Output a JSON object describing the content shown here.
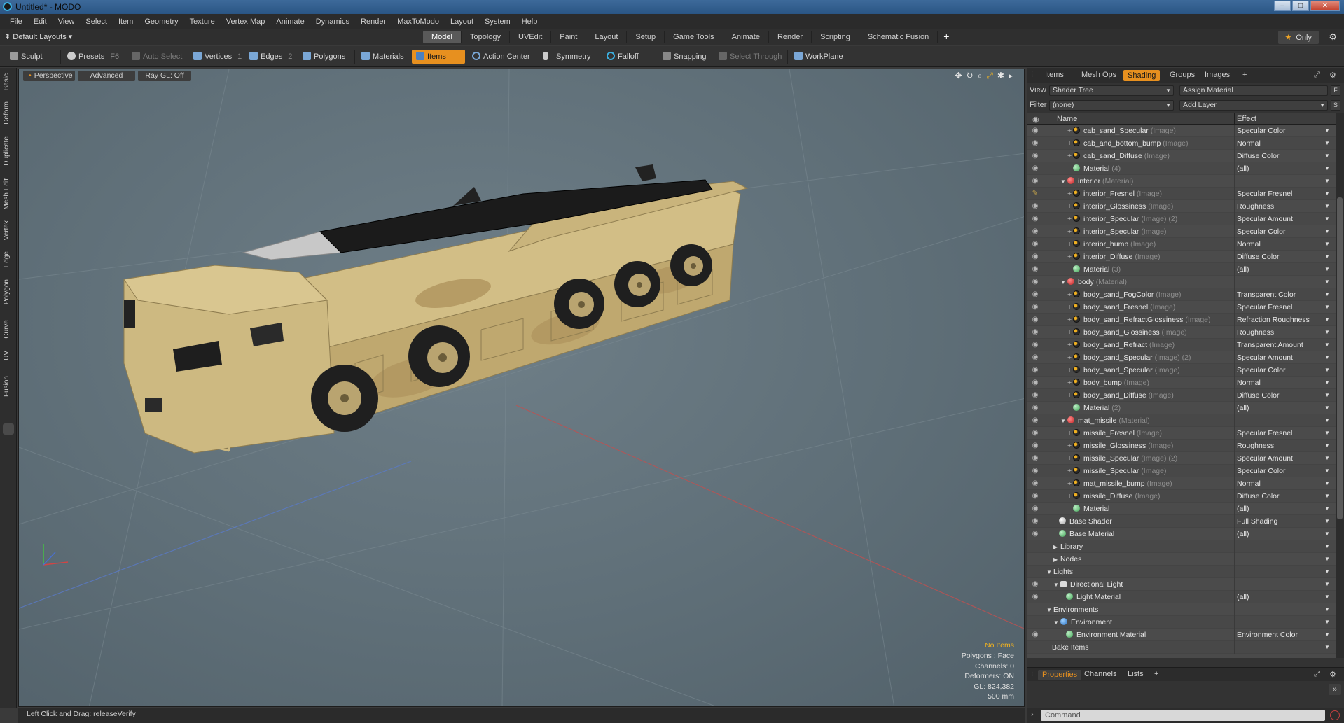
{
  "window": {
    "title": "Untitled* - MODO",
    "buttons": [
      "–",
      "□",
      "✕"
    ]
  },
  "menu": [
    "File",
    "Edit",
    "View",
    "Select",
    "Item",
    "Geometry",
    "Texture",
    "Vertex Map",
    "Animate",
    "Dynamics",
    "Render",
    "MaxToModo",
    "Layout",
    "System",
    "Help"
  ],
  "layouts": {
    "default_label": "Default Layouts ▾",
    "tabs": [
      "Model",
      "Topology",
      "UVEdit",
      "Paint",
      "Layout",
      "Setup",
      "Game Tools",
      "Animate",
      "Render",
      "Scripting",
      "Schematic Fusion"
    ],
    "active_tab": "Model",
    "plus": "+",
    "only": "Only"
  },
  "toolbar": {
    "sculpt": "Sculpt",
    "presets": "Presets",
    "presets_key": "F6",
    "auto_select": "Auto Select",
    "vertices": "Vertices",
    "vertices_key": "1",
    "edges": "Edges",
    "edges_key": "2",
    "polygons": "Polygons",
    "materials": "Materials",
    "items": "Items",
    "action_center": "Action Center",
    "symmetry": "Symmetry",
    "falloff": "Falloff",
    "snapping": "Snapping",
    "select_through": "Select Through",
    "workplane": "WorkPlane"
  },
  "left_strip": [
    "Basic",
    "Deform",
    "Duplicate",
    "Mesh Edit",
    "Vertex",
    "Edge",
    "Polygon",
    "Curve",
    "UV",
    "Fusion"
  ],
  "viewport": {
    "view_mode": "Perspective",
    "advanced": "Advanced",
    "raygl": "Ray GL: Off",
    "info": {
      "selection": "No Items",
      "polygons": "Polygons : Face",
      "channels": "Channels: 0",
      "deformers": "Deformers: ON",
      "gl": "GL: 824,382",
      "scale": "500 mm"
    }
  },
  "status": {
    "hint": "Left Click and Drag:   releaseVerify"
  },
  "panel": {
    "tabs": [
      "Items",
      "Mesh Ops",
      "Shading",
      "Groups",
      "Images",
      "+"
    ],
    "active_tab": "Shading",
    "view_label": "View",
    "view_value": "Shader Tree",
    "assign_material": "Assign Material",
    "filter_label": "Filter",
    "filter_value": "(none)",
    "add_layer": "Add Layer",
    "f_btn": "F",
    "s_btn": "S",
    "col_name": "Name",
    "col_effect": "Effect",
    "rows": [
      {
        "indent": 4,
        "plus": true,
        "icon": "image",
        "name": "cab_sand_Specular",
        "type": "(Image)",
        "effect": "Specular Color",
        "eye": "eye"
      },
      {
        "indent": 4,
        "plus": true,
        "icon": "image",
        "name": "cab_and_bottom_bump",
        "type": "(Image)",
        "effect": "Normal",
        "eye": "eye"
      },
      {
        "indent": 4,
        "plus": true,
        "icon": "image",
        "name": "cab_sand_Diffuse",
        "type": "(Image)",
        "effect": "Diffuse Color",
        "eye": "eye"
      },
      {
        "indent": 4,
        "plus": false,
        "icon": "material",
        "name": "Material",
        "type": "(4)",
        "effect": "(all)",
        "eye": "eye"
      },
      {
        "indent": 3,
        "twist": "▼",
        "icon": "mask",
        "name": "interior",
        "type": "(Material)",
        "effect": "",
        "eye": "eye"
      },
      {
        "indent": 4,
        "plus": true,
        "icon": "image",
        "name": "interior_Fresnel",
        "type": "(Image)",
        "effect": "Specular Fresnel",
        "eye": "brush"
      },
      {
        "indent": 4,
        "plus": true,
        "icon": "image",
        "name": "interior_Glossiness",
        "type": "(Image)",
        "effect": "Roughness",
        "eye": "eye"
      },
      {
        "indent": 4,
        "plus": true,
        "icon": "image",
        "name": "interior_Specular",
        "type": "(Image) (2)",
        "effect": "Specular Amount",
        "eye": "eye"
      },
      {
        "indent": 4,
        "plus": true,
        "icon": "image",
        "name": "interior_Specular",
        "type": "(Image)",
        "effect": "Specular Color",
        "eye": "eye"
      },
      {
        "indent": 4,
        "plus": true,
        "icon": "image",
        "name": "interior_bump",
        "type": "(Image)",
        "effect": "Normal",
        "eye": "eye"
      },
      {
        "indent": 4,
        "plus": true,
        "icon": "image",
        "name": "interior_Diffuse",
        "type": "(Image)",
        "effect": "Diffuse Color",
        "eye": "eye"
      },
      {
        "indent": 4,
        "plus": false,
        "icon": "material",
        "name": "Material",
        "type": "(3)",
        "effect": "(all)",
        "eye": "eye"
      },
      {
        "indent": 3,
        "twist": "▼",
        "icon": "mask",
        "name": "body",
        "type": "(Material)",
        "effect": "",
        "eye": "eye"
      },
      {
        "indent": 4,
        "plus": true,
        "icon": "image",
        "name": "body_sand_FogColor",
        "type": "(Image)",
        "effect": "Transparent Color",
        "eye": "eye"
      },
      {
        "indent": 4,
        "plus": true,
        "icon": "image",
        "name": "body_sand_Fresnel",
        "type": "(Image)",
        "effect": "Specular Fresnel",
        "eye": "eye"
      },
      {
        "indent": 4,
        "plus": true,
        "icon": "image",
        "name": "body_sand_RefractGlossiness",
        "type": "(Image)",
        "effect": "Refraction Roughness",
        "eye": "eye"
      },
      {
        "indent": 4,
        "plus": true,
        "icon": "image",
        "name": "body_sand_Glossiness",
        "type": "(Image)",
        "effect": "Roughness",
        "eye": "eye"
      },
      {
        "indent": 4,
        "plus": true,
        "icon": "image",
        "name": "body_sand_Refract",
        "type": "(Image)",
        "effect": "Transparent Amount",
        "eye": "eye"
      },
      {
        "indent": 4,
        "plus": true,
        "icon": "image",
        "name": "body_sand_Specular",
        "type": "(Image) (2)",
        "effect": "Specular Amount",
        "eye": "eye"
      },
      {
        "indent": 4,
        "plus": true,
        "icon": "image",
        "name": "body_sand_Specular",
        "type": "(Image)",
        "effect": "Specular Color",
        "eye": "eye"
      },
      {
        "indent": 4,
        "plus": true,
        "icon": "image",
        "name": "body_bump",
        "type": "(Image)",
        "effect": "Normal",
        "eye": "eye"
      },
      {
        "indent": 4,
        "plus": true,
        "icon": "image",
        "name": "body_sand_Diffuse",
        "type": "(Image)",
        "effect": "Diffuse Color",
        "eye": "eye"
      },
      {
        "indent": 4,
        "plus": false,
        "icon": "material",
        "name": "Material",
        "type": "(2)",
        "effect": "(all)",
        "eye": "eye"
      },
      {
        "indent": 3,
        "twist": "▼",
        "icon": "mask",
        "name": "mat_missile",
        "type": "(Material)",
        "effect": "",
        "eye": "eye"
      },
      {
        "indent": 4,
        "plus": true,
        "icon": "image",
        "name": "missile_Fresnel",
        "type": "(Image)",
        "effect": "Specular Fresnel",
        "eye": "eye"
      },
      {
        "indent": 4,
        "plus": true,
        "icon": "image",
        "name": "missile_Glossiness",
        "type": "(Image)",
        "effect": "Roughness",
        "eye": "eye"
      },
      {
        "indent": 4,
        "plus": true,
        "icon": "image",
        "name": "missile_Specular",
        "type": "(Image) (2)",
        "effect": "Specular Amount",
        "eye": "eye"
      },
      {
        "indent": 4,
        "plus": true,
        "icon": "image",
        "name": "missile_Specular",
        "type": "(Image)",
        "effect": "Specular Color",
        "eye": "eye"
      },
      {
        "indent": 4,
        "plus": true,
        "icon": "image",
        "name": "mat_missile_bump",
        "type": "(Image)",
        "effect": "Normal",
        "eye": "eye"
      },
      {
        "indent": 4,
        "plus": true,
        "icon": "image",
        "name": "missile_Diffuse",
        "type": "(Image)",
        "effect": "Diffuse Color",
        "eye": "eye"
      },
      {
        "indent": 4,
        "plus": false,
        "icon": "material",
        "name": "Material",
        "type": "",
        "effect": "(all)",
        "eye": "eye"
      },
      {
        "indent": 2,
        "plus": false,
        "icon": "shader",
        "name": "Base Shader",
        "type": "",
        "effect": "Full Shading",
        "eye": "eye"
      },
      {
        "indent": 2,
        "plus": false,
        "icon": "material",
        "name": "Base Material",
        "type": "",
        "effect": "(all)",
        "eye": "eye"
      },
      {
        "indent": 2,
        "twist": "▶",
        "icon": "",
        "name": "Library",
        "type": "",
        "effect": "",
        "eye": ""
      },
      {
        "indent": 2,
        "twist": "▶",
        "icon": "",
        "name": "Nodes",
        "type": "",
        "effect": "",
        "eye": ""
      },
      {
        "indent": 1,
        "twist": "▼",
        "icon": "",
        "name": "Lights",
        "type": "",
        "effect": "",
        "eye": ""
      },
      {
        "indent": 2,
        "twist": "▼",
        "icon": "light",
        "name": "Directional Light",
        "type": "",
        "effect": "",
        "eye": "eye"
      },
      {
        "indent": 3,
        "plus": false,
        "icon": "material",
        "name": "Light Material",
        "type": "",
        "effect": "(all)",
        "eye": "eye"
      },
      {
        "indent": 1,
        "twist": "▼",
        "icon": "",
        "name": "Environments",
        "type": "",
        "effect": "",
        "eye": ""
      },
      {
        "indent": 2,
        "twist": "▼",
        "icon": "env",
        "name": "Environment",
        "type": "",
        "effect": "",
        "eye": ""
      },
      {
        "indent": 3,
        "plus": false,
        "icon": "material",
        "name": "Environment Material",
        "type": "",
        "effect": "Environment Color",
        "eye": "eye"
      },
      {
        "indent": 1,
        "plus": false,
        "icon": "",
        "name": "Bake Items",
        "type": "",
        "effect": "",
        "eye": ""
      }
    ],
    "bottom_tabs": [
      "Properties",
      "Channels",
      "Lists",
      "+"
    ],
    "active_bottom_tab": "Properties",
    "command_placeholder": "Command"
  },
  "colors": {
    "accent": "#e7901f",
    "viewport_bg": "#66757e",
    "panel_bg": "#4a4a4a",
    "sand": "#c8b27a"
  }
}
